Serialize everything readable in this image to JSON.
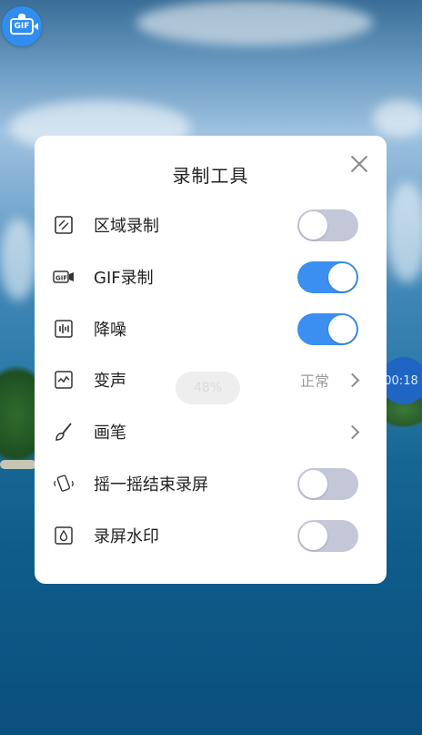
{
  "overlay": {
    "gif_badge_text": "GIF",
    "timer_text": "00:18"
  },
  "panel": {
    "title": "录制工具",
    "progress_text": "48%",
    "items": [
      {
        "label": "区域录制",
        "icon": "region-record-icon",
        "control": "toggle",
        "on": false
      },
      {
        "label": "GIF录制",
        "icon": "gif-icon",
        "control": "toggle",
        "on": true
      },
      {
        "label": "降噪",
        "icon": "noise-reduction-icon",
        "control": "toggle",
        "on": true
      },
      {
        "label": "变声",
        "icon": "voice-change-icon",
        "control": "value",
        "value": "正常"
      },
      {
        "label": "画笔",
        "icon": "brush-icon",
        "control": "chevron"
      },
      {
        "label": "摇一摇结束录屏",
        "icon": "shake-phone-icon",
        "control": "toggle",
        "on": false
      },
      {
        "label": "录屏水印",
        "icon": "watermark-icon",
        "control": "toggle",
        "on": false
      }
    ]
  },
  "colors": {
    "toggle_on": "#3a8ff0",
    "toggle_off": "#c3c7d8",
    "badge": "#2f8ef0",
    "timer": "#1f66c4"
  }
}
